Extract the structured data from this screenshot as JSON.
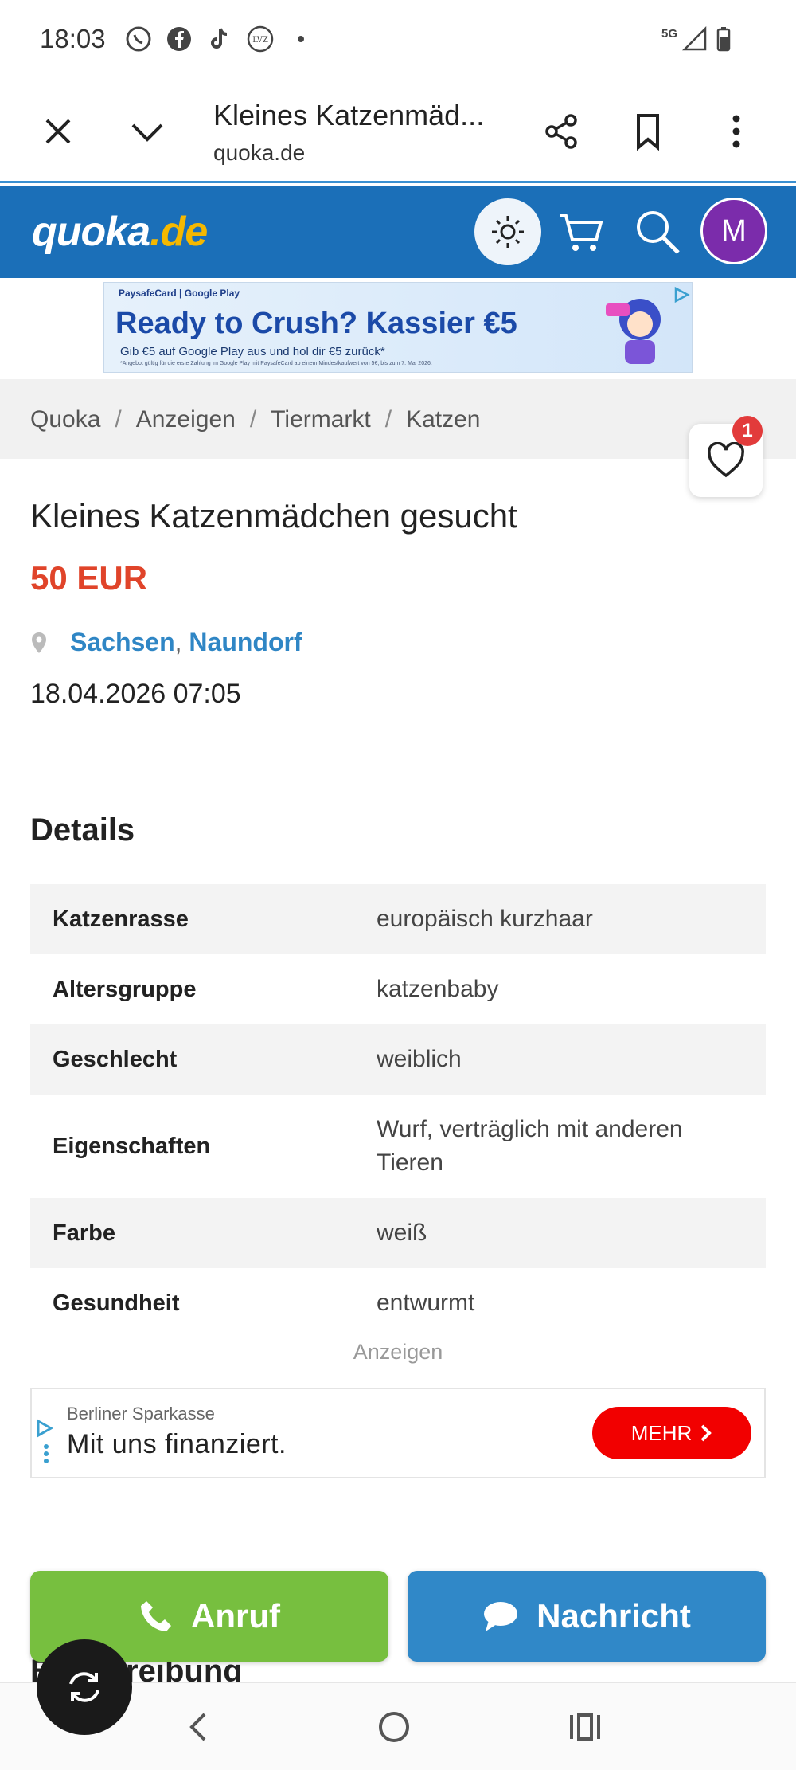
{
  "status_bar": {
    "time": "18:03",
    "network": "5G"
  },
  "browser": {
    "page_title": "Kleines Katzenmäd...",
    "domain": "quoka.de"
  },
  "site": {
    "logo_main": "quoka",
    "logo_tld": ".de",
    "avatar_initial": "M",
    "brand_color": "#1b6fb8",
    "accent_color": "#f5b800"
  },
  "ad_banner": {
    "brand": "PaysafeCard  |  Google Play",
    "headline": "Ready to Crush? Kassier €5",
    "subline": "Gib €5 auf Google Play aus und hol dir €5 zurück*",
    "fineprint": "*Angebot gültig für die erste Zahlung im Google Play mit PaysafeCard ab einem Mindestkaufwert von 5€, bis zum 7. Mai 2026."
  },
  "breadcrumb": [
    "Quoka",
    "Anzeigen",
    "Tiermarkt",
    "Katzen"
  ],
  "favorites_count": "1",
  "listing": {
    "title": "Kleines Katzenmädchen gesucht",
    "price": "50 EUR",
    "region": "Sachsen",
    "city": "Naundorf",
    "date": "18.04.2026 07:05"
  },
  "details": {
    "heading": "Details",
    "rows": [
      {
        "key": "Katzenrasse",
        "value": "europäisch kurzhaar"
      },
      {
        "key": "Altersgruppe",
        "value": "katzenbaby"
      },
      {
        "key": "Geschlecht",
        "value": "weiblich"
      },
      {
        "key": "Eigenschaften",
        "value": "Wurf, verträglich mit anderen Tieren"
      },
      {
        "key": "Farbe",
        "value": "weiß"
      },
      {
        "key": "Gesundheit",
        "value": "entwurmt"
      }
    ]
  },
  "ads_label": "Anzeigen",
  "text_ad": {
    "advertiser": "Berliner Sparkasse",
    "text": "Mit uns finanziert.",
    "button": "MEHR"
  },
  "description_heading": "Beschreibung",
  "actions": {
    "call": "Anruf",
    "message": "Nachricht"
  }
}
